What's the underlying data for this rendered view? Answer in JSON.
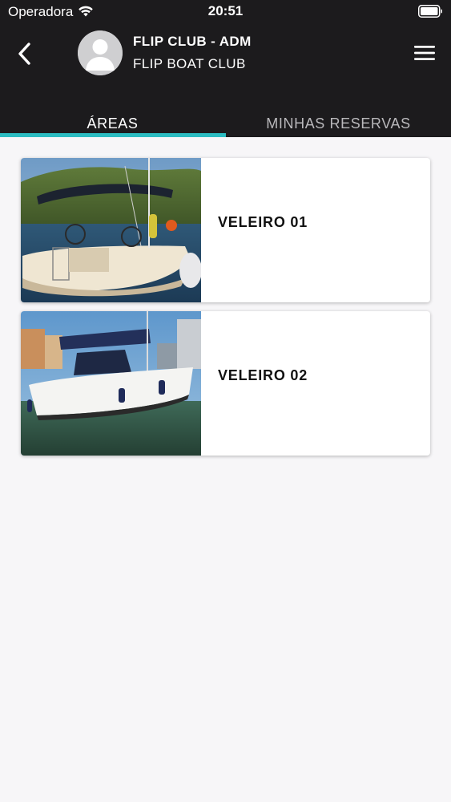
{
  "status_bar": {
    "carrier": "Operadora",
    "time": "20:51",
    "icons": [
      "wifi-icon",
      "battery-icon"
    ]
  },
  "header": {
    "title": "FLIP CLUB - ADM",
    "subtitle": "FLIP BOAT CLUB",
    "back_icon": "chevron-left-icon",
    "menu_icon": "hamburger-menu-icon",
    "avatar_icon": "user-avatar-icon"
  },
  "tabs": [
    {
      "label": "ÁREAS",
      "active": true
    },
    {
      "label": "MINHAS RESERVAS",
      "active": false
    }
  ],
  "areas": [
    {
      "name": "VELEIRO 01",
      "image": "sailboat-photo-1"
    },
    {
      "name": "VELEIRO 02",
      "image": "sailboat-photo-2"
    }
  ],
  "colors": {
    "header_bg": "#1c1b1d",
    "accent": "#2bbcc1",
    "page_bg": "#f7f6f8",
    "inactive_tab": "#b9b8bb"
  }
}
